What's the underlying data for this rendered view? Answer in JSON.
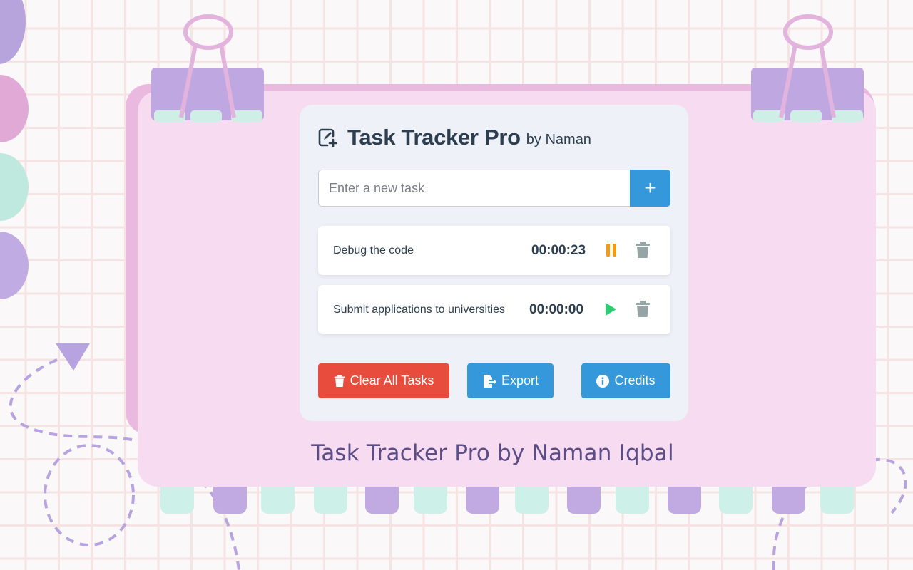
{
  "app": {
    "title": "Task Tracker Pro",
    "byline": "by Naman",
    "icon": "edit-square-plus-icon"
  },
  "input": {
    "value": "",
    "placeholder": "Enter a new task",
    "add_label": "+"
  },
  "tasks": [
    {
      "name": "Debug the code",
      "time": "00:00:23",
      "state": "running",
      "toggle_icon": "pause-icon",
      "delete_icon": "trash-icon"
    },
    {
      "name": "Submit applications to universities",
      "time": "00:00:00",
      "state": "paused",
      "toggle_icon": "play-icon",
      "delete_icon": "trash-icon"
    }
  ],
  "actions": {
    "clear_label": "Clear All Tasks",
    "export_label": "Export",
    "credits_label": "Credits"
  },
  "footer": {
    "caption": "Task Tracker Pro by Naman Iqbal"
  },
  "colors": {
    "primary": "#3498db",
    "danger": "#e74c3c",
    "pause": "#f39c12",
    "play": "#2ecc71",
    "trash": "#95a5a6",
    "text": "#2c3e50",
    "board": "#f6dbf1",
    "caption": "#5b4d86"
  }
}
